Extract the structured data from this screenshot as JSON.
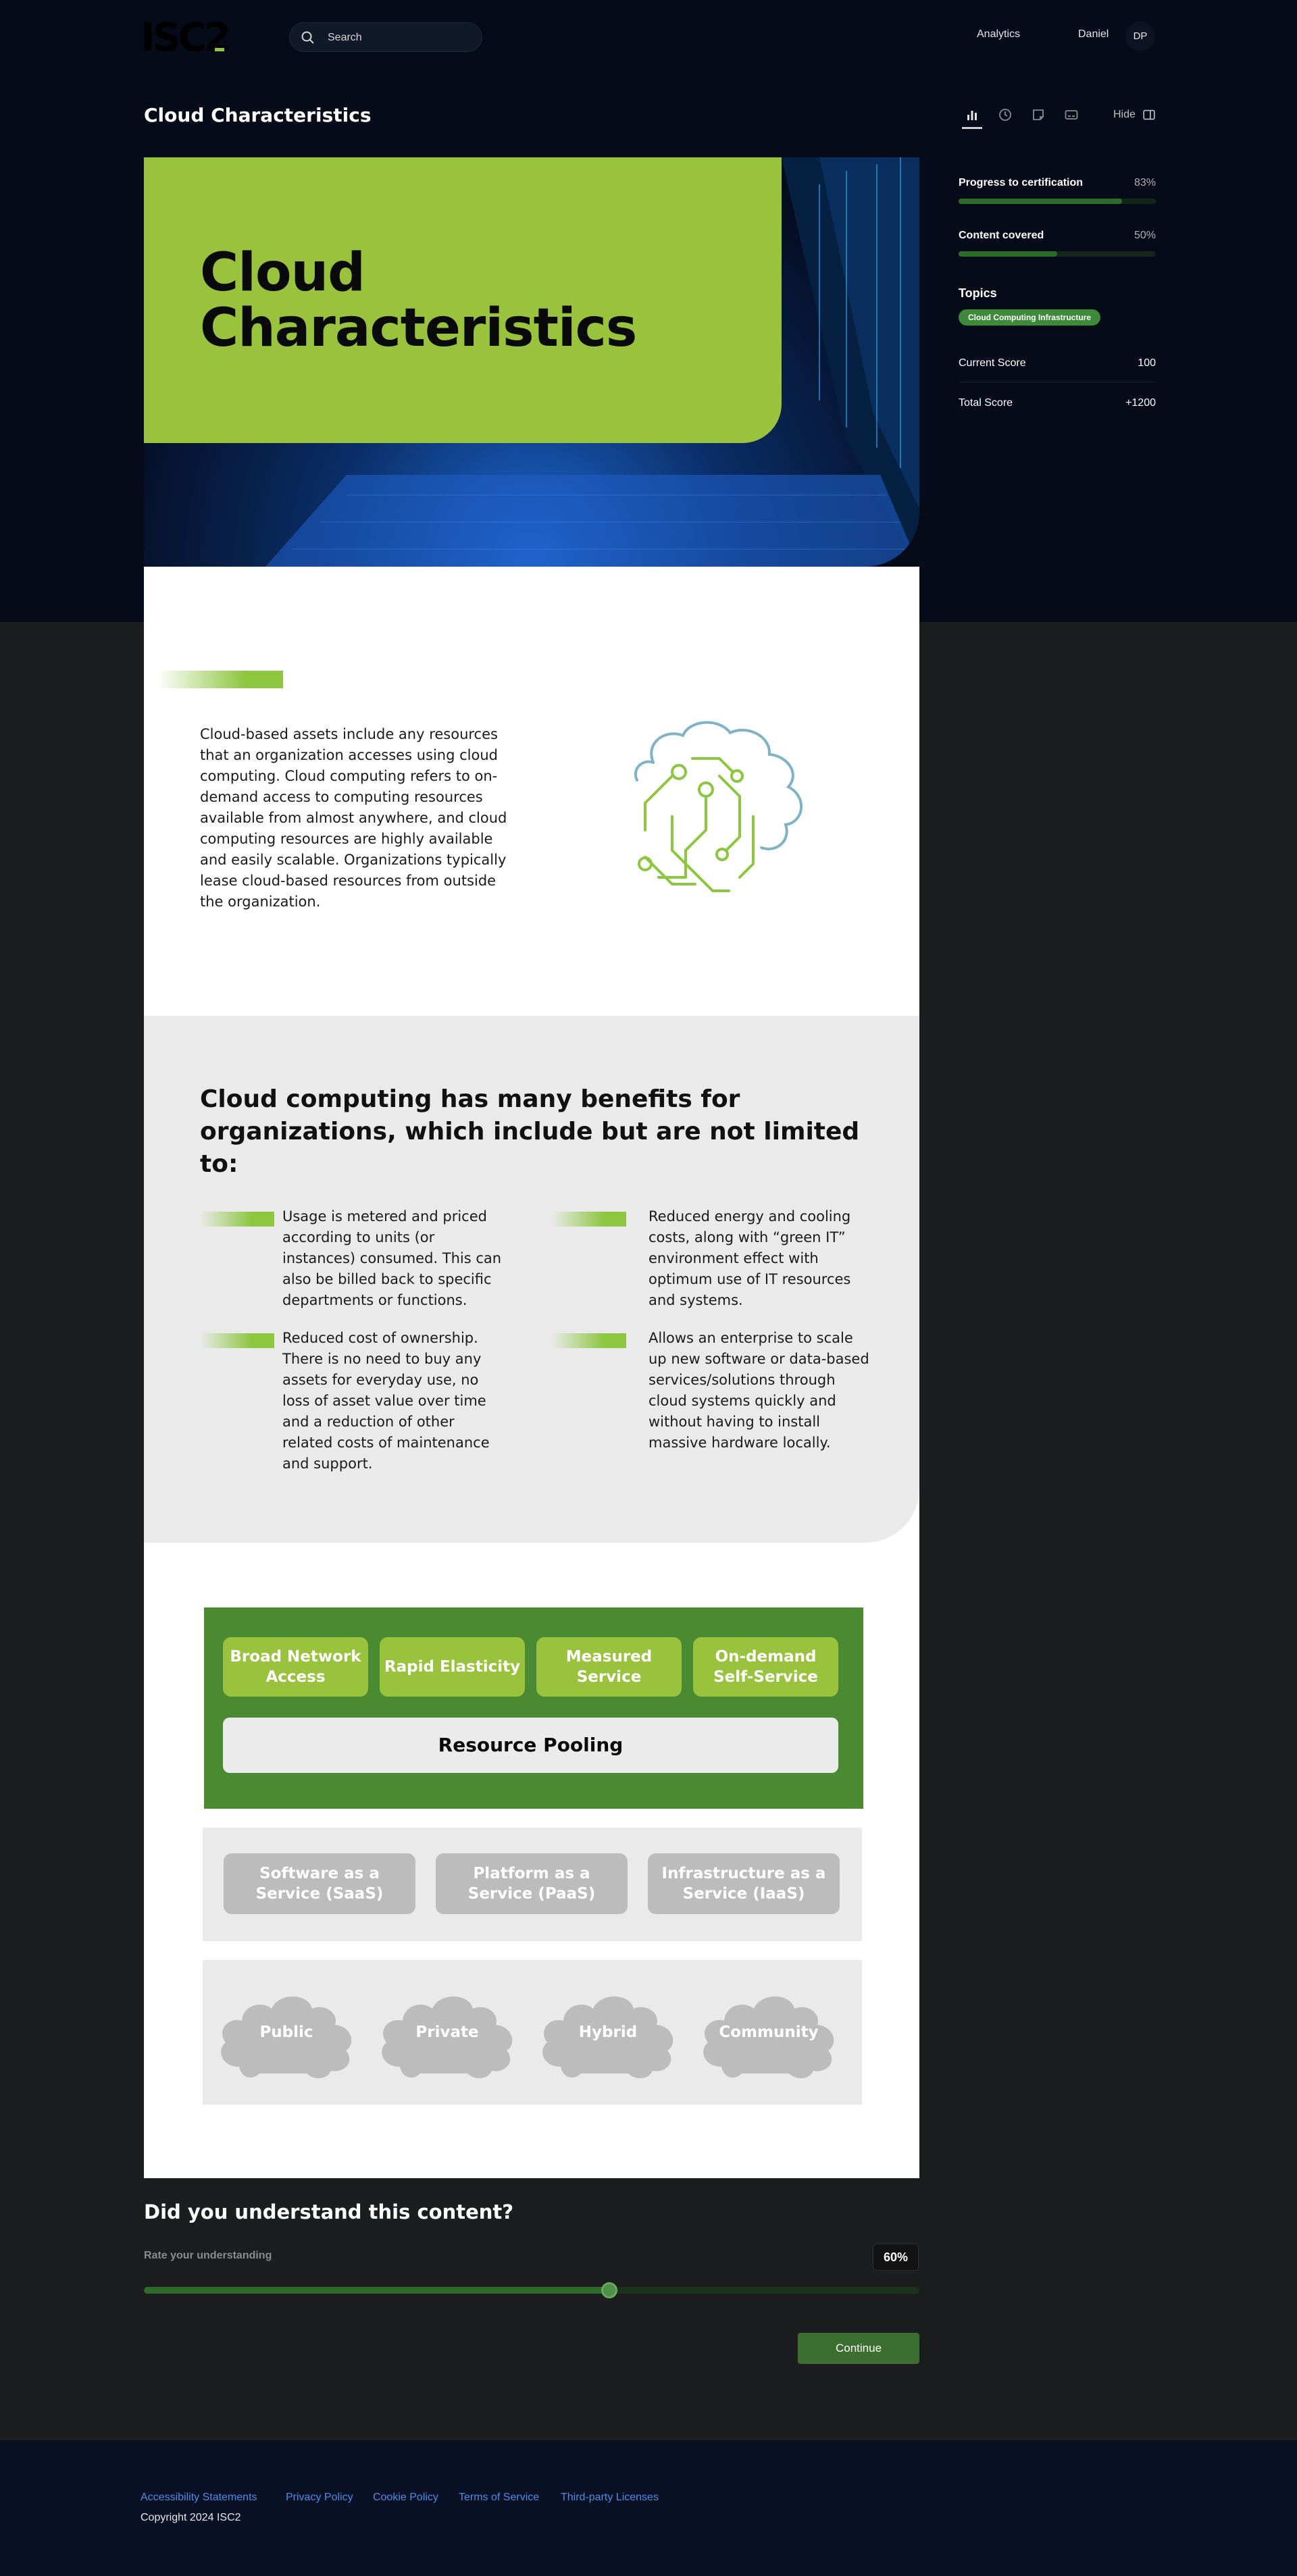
{
  "header": {
    "logo": "ISC2",
    "search_placeholder": "Search",
    "nav_analytics": "Analytics",
    "user_name": "Daniel",
    "user_initials": "DP"
  },
  "page": {
    "title": "Cloud Characteristics",
    "hide_label": "Hide"
  },
  "hero": {
    "title_line1": "Cloud",
    "title_line2": "Characteristics"
  },
  "intro": {
    "text": "Cloud-based assets include any resources that an organization accesses using cloud computing. Cloud computing refers to on-demand access to computing resources available from almost anywhere, and cloud computing resources are highly available and easily scalable. Organizations typically lease cloud-based resources from outside the organization."
  },
  "benefits": {
    "heading": "Cloud computing has many benefits for organizations, which include but are not limited to:",
    "items": [
      "Usage is metered and priced according to units (or instances) consumed. This can also be billed back to specific departments or functions.",
      "Reduced energy and cooling costs, along with “green IT” environment effect with optimum use of IT resources and systems.",
      "Reduced cost of ownership. There is no need to buy any assets for everyday use, no loss of asset value over time and a reduction of other related costs of maintenance and support.",
      "Allows an enterprise to scale up new software or data-based services/solutions through cloud systems quickly and without  having to install massive hardware locally."
    ]
  },
  "diagram": {
    "characteristics": [
      "Broad Network Access",
      "Rapid Elasticity",
      "Measured Service",
      "On-demand Self-Service"
    ],
    "pooling": "Resource Pooling",
    "service_models": [
      "Software as a Service (SaaS)",
      "Platform as a Service (PaaS)",
      "Infrastructure as a Service (IaaS)"
    ],
    "deployment_models": [
      "Public",
      "Private",
      "Hybrid",
      "Community"
    ]
  },
  "understanding": {
    "title": "Did you understand this content?",
    "rate_label": "Rate your understanding",
    "value_text": "60%",
    "value": 0.6,
    "continue_label": "Continue"
  },
  "sidebar": {
    "progress_label": "Progress to certification",
    "progress_text": "83%",
    "progress": 0.83,
    "content_label": "Content covered",
    "content_text": "50%",
    "content": 0.5,
    "topics_heading": "Topics",
    "topic_chip": "Cloud Computing Infrastructure",
    "current_score_label": "Current Score",
    "current_score": "100",
    "total_score_label": "Total Score",
    "total_score": "+1200"
  },
  "footer": {
    "links": [
      "Accessibility Statements",
      "Privacy Policy",
      "Cookie Policy",
      "Terms of Service",
      "Third-party Licenses"
    ],
    "copyright": "Copyright 2024 ISC2"
  },
  "colors": {
    "accent_green": "#99c23d",
    "dark_green": "#4a8a33",
    "link_blue": "#4d8ce8",
    "page_dark": "#050b18"
  }
}
